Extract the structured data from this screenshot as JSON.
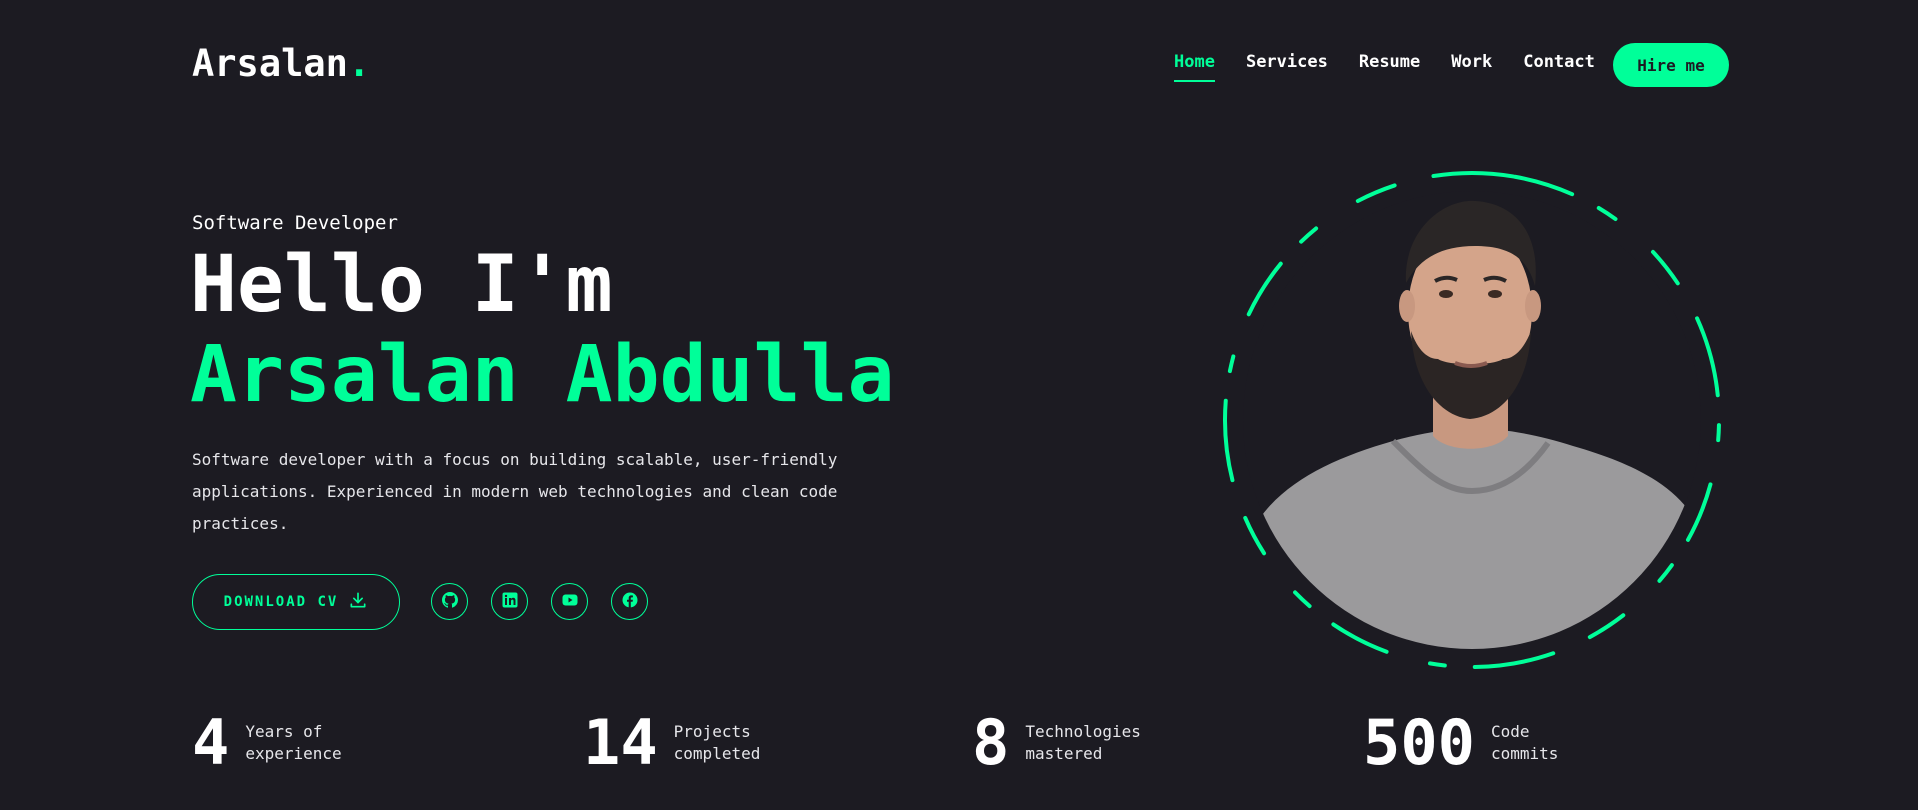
{
  "header": {
    "logo_text": "Arsalan",
    "logo_dot": ".",
    "nav": [
      {
        "label": "Home",
        "active": true
      },
      {
        "label": "Services",
        "active": false
      },
      {
        "label": "Resume",
        "active": false
      },
      {
        "label": "Work",
        "active": false
      },
      {
        "label": "Contact",
        "active": false
      }
    ],
    "hire_label": "Hire me"
  },
  "hero": {
    "role": "Software Developer",
    "greeting": "Hello I'm",
    "name": "Arsalan Abdulla",
    "description": "Software developer with a focus on building scalable, user-friendly applications. Experienced in modern web technologies and clean code practices.",
    "download_label": "DOWNLOAD CV",
    "socials": [
      "github-icon",
      "linkedin-icon",
      "youtube-icon",
      "facebook-icon"
    ]
  },
  "stats": [
    {
      "value": "4",
      "label": "Years of\nexperience"
    },
    {
      "value": "14",
      "label": "Projects\ncompleted"
    },
    {
      "value": "8",
      "label": "Technologies\nmastered"
    },
    {
      "value": "500",
      "label": "Code\ncommits"
    }
  ],
  "colors": {
    "accent": "#00ff99",
    "background": "#1c1b22",
    "text": "#ffffff"
  }
}
